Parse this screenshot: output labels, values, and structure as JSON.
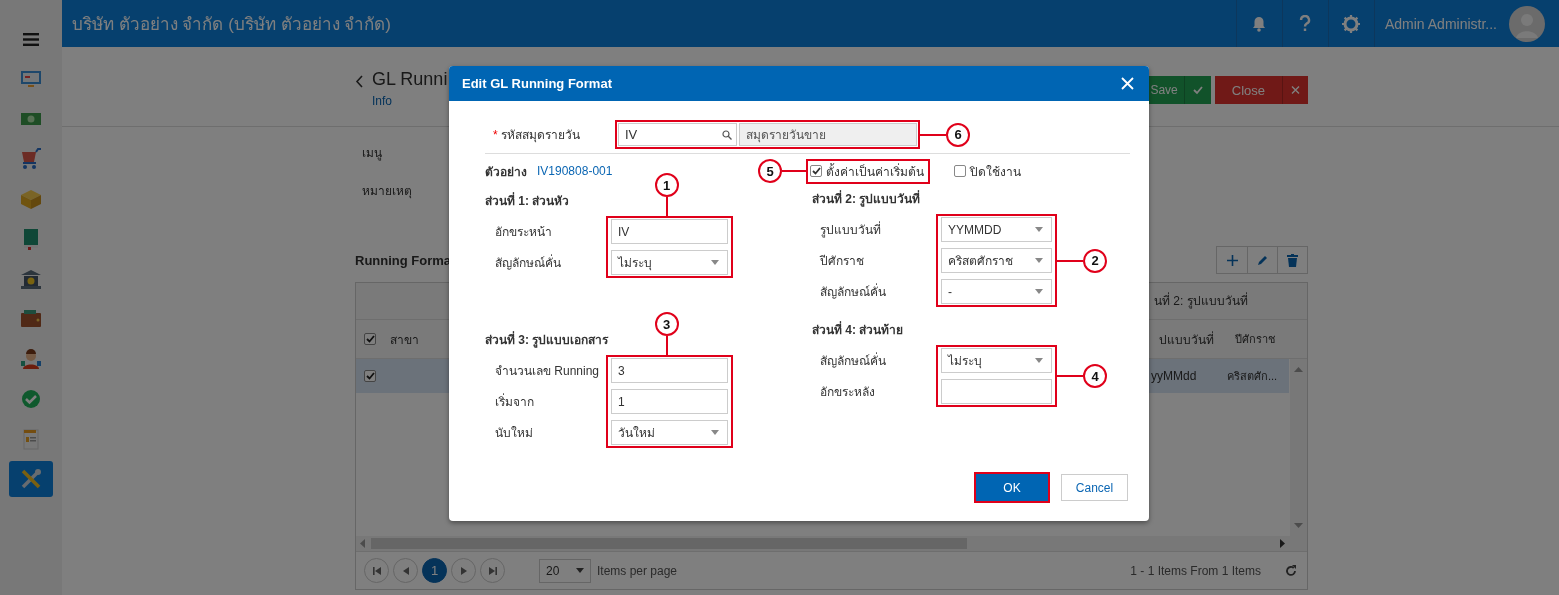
{
  "sidebar": {
    "items": [
      {
        "kind": "monitor",
        "selected": false
      },
      {
        "kind": "banknote",
        "selected": false
      },
      {
        "kind": "cart",
        "selected": false
      },
      {
        "kind": "box",
        "selected": false
      },
      {
        "kind": "book",
        "selected": false
      },
      {
        "kind": "bank",
        "selected": false
      },
      {
        "kind": "wallet",
        "selected": false
      },
      {
        "kind": "person",
        "selected": false
      },
      {
        "kind": "check",
        "selected": false
      },
      {
        "kind": "document",
        "selected": false
      },
      {
        "kind": "tools",
        "selected": true
      }
    ]
  },
  "top_bar": {
    "title": "บริษัท ตัวอย่าง จำกัด (บริษัท ตัวอย่าง จำกัด)",
    "user": "Admin Administr..."
  },
  "page": {
    "title": "GL Runni",
    "subtitle": "Info",
    "buttons": [
      {
        "kind": "save",
        "label": "Save"
      },
      {
        "kind": "close",
        "label": "Close"
      }
    ],
    "fields": [
      "เมนู",
      "หมายเหตุ"
    ],
    "section_title": "Running Forma",
    "table": {
      "group_header": "นที่ 2: รูปแบบวันที่",
      "header_checked": true,
      "columns": [
        "สาขา",
        "ปแบบวันที่",
        "ปีศักราช"
      ],
      "rows": [
        {
          "selected": true,
          "checked": true,
          "date_format": "yyMMdd",
          "era": "คริสตศัก..."
        }
      ]
    },
    "pager": {
      "pages": [
        {
          "label": "1",
          "selected": true
        }
      ],
      "page_size": "20",
      "page_size_label": "Items per page",
      "summary": "1 - 1 Items From 1 Items"
    }
  },
  "dialog": {
    "title": "Edit GL Running Format",
    "journal": {
      "label": "รหัสสมุดรายวัน",
      "required_mark": "*",
      "code": "IV",
      "name": "สมุดรายวันขาย",
      "marker": {
        "label": "6"
      }
    },
    "sample": {
      "label": "ตัวอย่าง",
      "value": "IV190808-001"
    },
    "options": [
      {
        "label": "ตั้งค่าเป็นค่าเริ่มต้น",
        "checked": true,
        "marker": {
          "label": "5"
        }
      },
      {
        "label": "ปิดใช้งาน",
        "checked": false
      }
    ],
    "sections": [
      {
        "title": "ส่วนที่ 1: ส่วนหัว",
        "marker": {
          "label": "1"
        },
        "fields": [
          {
            "kind": "input",
            "label": "อักขระหน้า",
            "value": "IV"
          },
          {
            "kind": "select",
            "label": "สัญลักษณ์คั่น",
            "value": "ไม่ระบุ"
          }
        ]
      },
      {
        "title": "ส่วนที่ 2: รูปแบบวันที่",
        "marker": {
          "label": "2"
        },
        "fields": [
          {
            "kind": "select",
            "label": "รูปแบบวันที่",
            "value": "YYMMDD"
          },
          {
            "kind": "select",
            "label": "ปีศักราช",
            "value": "คริสตศักราช"
          },
          {
            "kind": "select",
            "label": "สัญลักษณ์คั่น",
            "value": "-"
          }
        ]
      },
      {
        "title": "ส่วนที่ 3: รูปแบบเอกสาร",
        "marker": {
          "label": "3"
        },
        "fields": [
          {
            "kind": "input",
            "label": "จำนวนเลข Running",
            "value": "3"
          },
          {
            "kind": "input",
            "label": "เริ่มจาก",
            "value": "1"
          },
          {
            "kind": "select",
            "label": "นับใหม่",
            "value": "วันใหม่"
          }
        ]
      },
      {
        "title": "ส่วนที่ 4: ส่วนท้าย",
        "marker": {
          "label": "4"
        },
        "fields": [
          {
            "kind": "select",
            "label": "สัญลักษณ์คั่น",
            "value": "ไม่ระบุ"
          },
          {
            "kind": "input",
            "label": "อักขระหลัง"
          }
        ]
      }
    ],
    "buttons": [
      {
        "kind": "primary",
        "label": "OK",
        "highlighted": true
      },
      {
        "kind": "secondary",
        "label": "Cancel",
        "highlighted": false
      }
    ]
  }
}
